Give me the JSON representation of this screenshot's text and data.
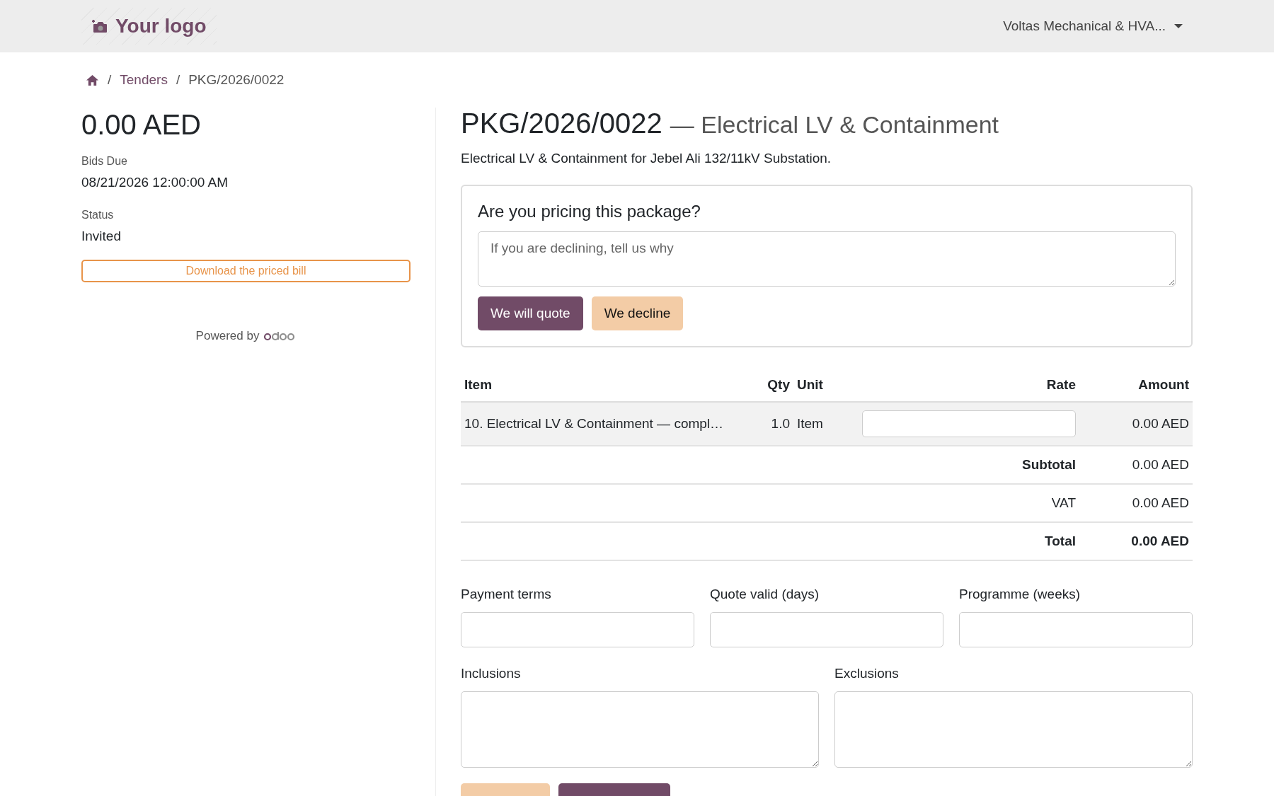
{
  "header": {
    "logo_text": "Your logo",
    "company": "Voltas Mechanical & HVA..."
  },
  "breadcrumb": [
    {
      "separator": "/",
      "label": "Tenders",
      "kind": "link"
    },
    {
      "separator": "/",
      "label": "PKG/2026/0022",
      "kind": "current"
    }
  ],
  "sidebar": {
    "amount": "0.00 AED",
    "fields": [
      {
        "label": "Bids Due",
        "value": "08/21/2026 12:00:00 AM"
      },
      {
        "label": "Status",
        "value": "Invited"
      }
    ],
    "download_button": "Download the priced bill",
    "powered_by": "Powered by"
  },
  "tender": {
    "code": "PKG/2026/0022",
    "subtitle": "— Electrical LV & Containment",
    "description": "Electrical LV & Containment for Jebel Ali 132/11kV Substation."
  },
  "pricing_card": {
    "question": "Are you pricing this package?",
    "reason": {
      "placeholder": "If you are declining, tell us why"
    },
    "buttons": [
      {
        "label": "We will quote",
        "kind": "primary"
      },
      {
        "label": "We decline",
        "kind": "secondary"
      }
    ]
  },
  "table": {
    "columns": [
      "Item",
      "Qty",
      "Unit",
      "Rate",
      "Amount"
    ],
    "rows": [
      {
        "item": "10. Electrical LV & Containment — compl…",
        "qty": "1.0",
        "unit": "Item",
        "amount": "0.00 AED"
      }
    ],
    "totals": [
      {
        "label": "Subtotal",
        "value": "0.00 AED",
        "kind": "bold_label"
      },
      {
        "label": "VAT",
        "value": "0.00 AED",
        "kind": "plain"
      },
      {
        "label": "Total",
        "value": "0.00 AED",
        "kind": "bold"
      }
    ]
  },
  "terms_fields": [
    {
      "label": "Payment terms"
    },
    {
      "label": "Quote valid (days)"
    },
    {
      "label": "Programme (weeks)"
    }
  ],
  "scope_fields": [
    {
      "label": "Inclusions"
    },
    {
      "label": "Exclusions"
    }
  ],
  "footer_buttons": [
    {
      "kind": "secondary"
    },
    {
      "kind": "primary"
    }
  ]
}
